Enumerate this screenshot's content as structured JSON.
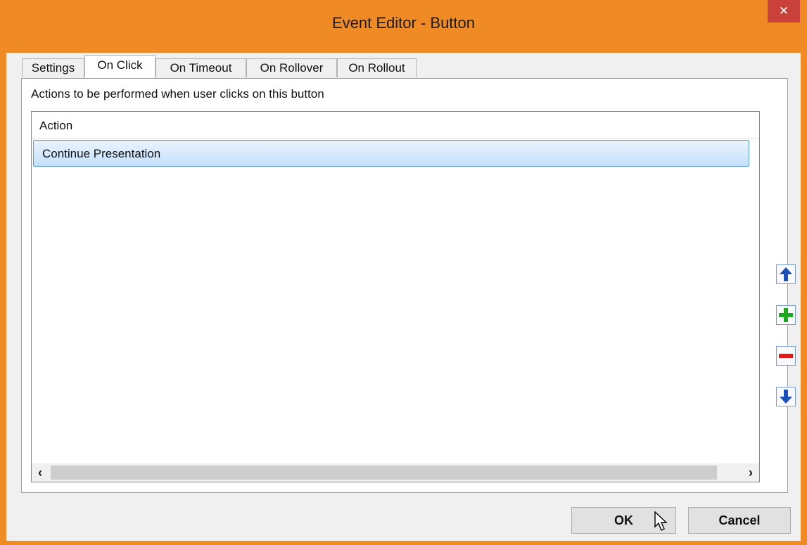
{
  "window": {
    "title": "Event Editor - Button",
    "close_label": "✕"
  },
  "tabs": [
    {
      "label": "Settings"
    },
    {
      "label": "On Click"
    },
    {
      "label": "On Timeout"
    },
    {
      "label": "On Rollover"
    },
    {
      "label": "On Rollout"
    }
  ],
  "panel": {
    "description": "Actions to be performed when user clicks on this button",
    "list": {
      "column_header": "Action",
      "rows": [
        "Continue Presentation"
      ]
    },
    "scroll_left": "‹",
    "scroll_right": "›"
  },
  "side_buttons": {
    "move_up": "arrow-up-icon",
    "add": "plus-icon",
    "remove": "minus-icon",
    "move_down": "arrow-down-icon"
  },
  "buttons": {
    "ok": "OK",
    "cancel": "Cancel"
  },
  "colors": {
    "titlebar": "#f08a24",
    "close": "#c9413a",
    "selection": "#c4e0fb",
    "arrow_blue": "#1d4fb8",
    "plus_green": "#1ea81e",
    "minus_red": "#e21a1a"
  }
}
